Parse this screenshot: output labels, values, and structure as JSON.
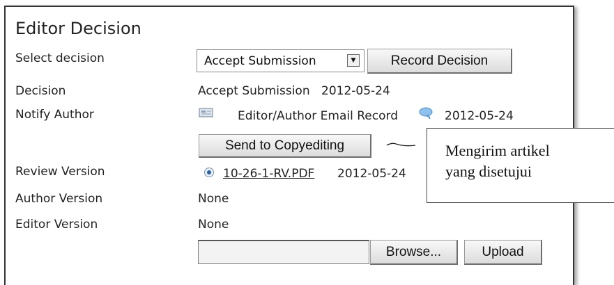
{
  "form": {
    "title": "Editor Decision",
    "select_decision_label": "Select decision",
    "decision_select_value": "Accept Submission",
    "record_decision_button": "Record Decision",
    "decision_label": "Decision",
    "decision_value": "Accept Submission",
    "decision_date": "2012-05-24",
    "notify_author_label": "Notify Author",
    "email_record_text": "Editor/Author Email Record",
    "notify_date": "2012-05-24",
    "send_to_copyediting_button": "Send to Copyediting",
    "review_version_label": "Review Version",
    "review_file_link": "10-26-1-RV.PDF",
    "review_date": "2012-05-24",
    "author_version_label": "Author Version",
    "author_version_value": "None",
    "editor_version_label": "Editor Version",
    "editor_version_value": "None",
    "browse_button": "Browse...",
    "upload_button": "Upload"
  },
  "annotation": {
    "line1": "Mengirim artikel",
    "line2": "yang disetujui"
  },
  "icons": {
    "email": "envelope-icon",
    "comment": "speech-bubble-icon",
    "radio": "radio-selected-icon"
  }
}
